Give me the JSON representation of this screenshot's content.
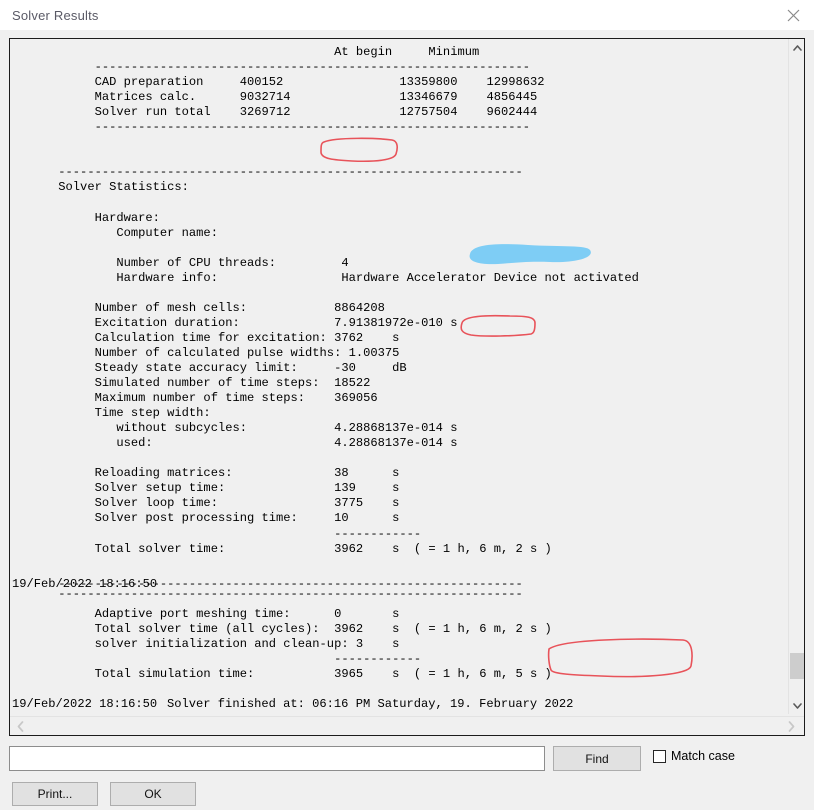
{
  "window": {
    "title": "Solver Results",
    "close_icon": "close-icon"
  },
  "report": {
    "text": "                                           At begin     Minimum\n          ------------------------------------------------------------\n          CAD preparation     400152                13359800    12998632\n          Matrices calc.      9032714               13346679    4856445\n          Solver run total    3269712               12757504    9602444\n          ------------------------------------------------------------\n\n\n     ----------------------------------------------------------------\n     Solver Statistics:\n\n          Hardware:\n             Computer name:\n\n             Number of CPU threads:         4\n             Hardware info:                 Hardware Accelerator Device not activated\n\n          Number of mesh cells:            8864208\n          Excitation duration:             7.91381972e-010 s\n          Calculation time for excitation: 3762    s\n          Number of calculated pulse widths: 1.00375\n          Steady state accuracy limit:     -30     dB\n          Simulated number of time steps:  18522\n          Maximum number of time steps:    369056\n          Time step width:\n             without subcycles:            4.28868137e-014 s\n             used:                         4.28868137e-014 s\n\n          Reloading matrices:              38      s\n          Solver setup time:               139     s\n          Solver loop time:                3775    s\n          Solver post processing time:     10      s\n                                           ------------\n          Total solver time:               3962    s  ( = 1 h, 6 m, 2 s )\n\n\n     ----------------------------------------------------------------"
  },
  "log_lines": [
    {
      "timestamp": "19/Feb/2022 18:16:50",
      "text": ""
    },
    {
      "timestamp": "",
      "text": "          Adaptive port meshing time:      0       s"
    },
    {
      "timestamp": "",
      "text": "          Total solver time (all cycles):  3962    s  ( = 1 h, 6 m, 2 s )"
    },
    {
      "timestamp": "",
      "text": "          solver initialization and clean-up: 3    s"
    },
    {
      "timestamp": "",
      "text": "                                           ------------"
    },
    {
      "timestamp": "",
      "text": "          Total simulation time:           3965    s  ( = 1 h, 6 m, 5 s )"
    },
    {
      "timestamp": "",
      "text": ""
    },
    {
      "timestamp": "",
      "text": "     ----------------------------------------------------------------"
    },
    {
      "timestamp": "19/Feb/2022 18:16:50",
      "text": "Solver finished at: 06:16 PM Saturday, 19. February 2022"
    }
  ],
  "report_tail": "     ----------------------------------------------------------------\n\n          Adaptive port meshing time:      0       s\n          Total solver time (all cycles):  3962    s  ( = 1 h, 6 m, 2 s )\n          solver initialization and clean-up: 3    s\n                                           ------------\n          Total simulation time:           3965    s  ( = 1 h, 6 m, 5 s )\n\n\n     ----------------------------------------------------------------\n",
  "table": {
    "columns": [
      "",
      "",
      "At begin",
      "Minimum"
    ],
    "rows": [
      {
        "label": "CAD preparation",
        "value": "400152",
        "at_begin": "13359800",
        "minimum": "12998632"
      },
      {
        "label": "Matrices calc.",
        "value": "9032714",
        "at_begin": "13346679",
        "minimum": "4856445"
      },
      {
        "label": "Solver run total",
        "value": "3269712",
        "at_begin": "12757504",
        "minimum": "9602444"
      }
    ]
  },
  "statistics": {
    "heading": "Solver Statistics:",
    "hardware_heading": "Hardware:",
    "computer_name_label": "Computer name:",
    "computer_name_value": "",
    "entries": [
      {
        "label": "Number of CPU threads:",
        "value": "4",
        "unit": ""
      },
      {
        "label": "Hardware info:",
        "value": "Hardware Accelerator Device not activated",
        "unit": ""
      },
      {
        "label": "Number of mesh cells:",
        "value": "8864208",
        "unit": ""
      },
      {
        "label": "Excitation duration:",
        "value": "7.91381972e-010",
        "unit": "s"
      },
      {
        "label": "Calculation time for excitation:",
        "value": "3762",
        "unit": "s"
      },
      {
        "label": "Number of calculated pulse widths:",
        "value": "1.00375",
        "unit": ""
      },
      {
        "label": "Steady state accuracy limit:",
        "value": "-30",
        "unit": "dB"
      },
      {
        "label": "Simulated number of time steps:",
        "value": "18522",
        "unit": ""
      },
      {
        "label": "Maximum number of time steps:",
        "value": "369056",
        "unit": ""
      },
      {
        "label": "Time step width:",
        "value": "",
        "unit": ""
      },
      {
        "label": "without subcycles:",
        "value": "4.28868137e-014",
        "unit": "s"
      },
      {
        "label": "used:",
        "value": "4.28868137e-014",
        "unit": "s"
      },
      {
        "label": "Reloading matrices:",
        "value": "38",
        "unit": "s"
      },
      {
        "label": "Solver setup time:",
        "value": "139",
        "unit": "s"
      },
      {
        "label": "Solver loop time:",
        "value": "3775",
        "unit": "s"
      },
      {
        "label": "Solver post processing time:",
        "value": "10",
        "unit": "s"
      },
      {
        "label": "Total solver time:",
        "value": "3962",
        "unit": "s  ( = 1 h, 6 m, 2 s )"
      },
      {
        "label": "Adaptive port meshing time:",
        "value": "0",
        "unit": "s"
      },
      {
        "label": "Total solver time (all cycles):",
        "value": "3962",
        "unit": "s  ( = 1 h, 6 m, 2 s )"
      },
      {
        "label": "solver initialization and clean-up:",
        "value": "3",
        "unit": "s"
      },
      {
        "label": "Total simulation time:",
        "value": "3965",
        "unit": "s  ( = 1 h, 6 m, 5 s )"
      }
    ]
  },
  "timestamps": {
    "first": "19/Feb/2022 18:16:50",
    "second": "19/Feb/2022 18:16:50",
    "finished_line": "Solver finished at: 06:16 PM Saturday, 19. February 2022"
  },
  "annotations": {
    "color": "#e8535a",
    "redaction_color": "#7ecdf5",
    "marked_values": [
      "3269712",
      "8864208",
      "( = 1 h, 6 m, 5 s )"
    ]
  },
  "controls": {
    "search_value": "",
    "search_placeholder": "",
    "find_label": "Find",
    "match_case_label": "Match case",
    "match_case_checked": false,
    "print_label": "Print...",
    "ok_label": "OK"
  },
  "scrollbars": {
    "up_arrow": "chevron-up-icon",
    "down_arrow": "chevron-down-icon",
    "left_arrow": "chevron-left-icon",
    "right_arrow": "chevron-right-icon"
  }
}
